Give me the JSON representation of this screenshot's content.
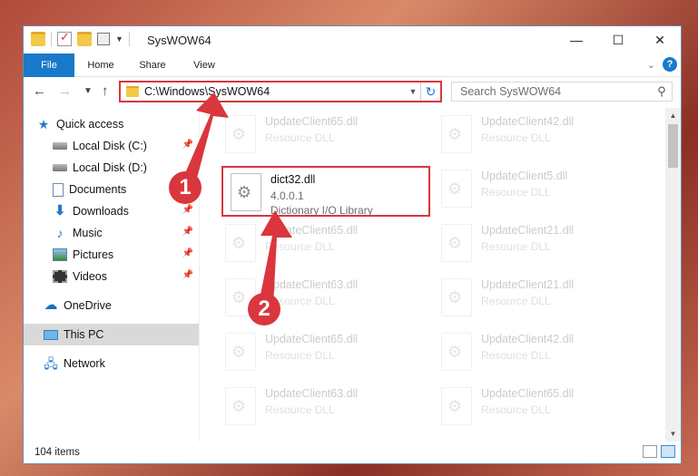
{
  "window": {
    "title": "SysWOW64",
    "minimize": "—",
    "maximize": "☐",
    "close": "✕"
  },
  "ribbon": {
    "tabs": [
      "File",
      "Home",
      "Share",
      "View"
    ]
  },
  "address": {
    "path": "C:\\Windows\\SysWOW64",
    "search_placeholder": "Search SysWOW64"
  },
  "nav": {
    "items": [
      {
        "label": "Quick access",
        "icon": "star-icon"
      },
      {
        "label": "Local Disk (C:)",
        "icon": "disk-icon",
        "pinned": true
      },
      {
        "label": "Local Disk (D:)",
        "icon": "disk-icon",
        "pinned": false
      },
      {
        "label": "Documents",
        "icon": "documents-icon",
        "pinned": true
      },
      {
        "label": "Downloads",
        "icon": "downloads-icon",
        "pinned": true
      },
      {
        "label": "Music",
        "icon": "music-icon",
        "pinned": true
      },
      {
        "label": "Pictures",
        "icon": "pictures-icon",
        "pinned": true
      },
      {
        "label": "Videos",
        "icon": "videos-icon",
        "pinned": true
      },
      {
        "label": "OneDrive",
        "icon": "cloud-icon"
      },
      {
        "label": "This PC",
        "icon": "computer-icon",
        "selected": true
      },
      {
        "label": "Network",
        "icon": "network-icon"
      }
    ]
  },
  "files": {
    "highlighted": {
      "name": "dict32.dll",
      "version": "4.0.0.1",
      "description": "Dictionary I/O Library"
    },
    "left_column": [
      {
        "name": "UpdateClient65.dll",
        "description": "Resource DLL"
      },
      {
        "name": "UpdateClient65.dll",
        "description": "Resource DLL"
      },
      {
        "name": "UpdateClient63.dll",
        "description": "Resource DLL"
      },
      {
        "name": "UpdateClient65.dll",
        "description": "Resource DLL"
      },
      {
        "name": "UpdateClient63.dll",
        "description": "Resource DLL"
      }
    ],
    "right_column": [
      {
        "name": "UpdateClient42.dll",
        "description": "Resource DLL"
      },
      {
        "name": "UpdateClient5.dll",
        "description": "Resource DLL"
      },
      {
        "name": "UpdateClient21.dll",
        "description": "Resource DLL"
      },
      {
        "name": "UpdateClient21.dll",
        "description": "Resource DLL"
      },
      {
        "name": "UpdateClient42.dll",
        "description": "Resource DLL"
      },
      {
        "name": "UpdateClient65.dll",
        "description": "Resource DLL"
      }
    ]
  },
  "status": {
    "item_count": "104 items"
  },
  "annotations": {
    "step1": "1",
    "step2": "2"
  },
  "colors": {
    "accent": "#1979ca",
    "highlight": "#d9363e"
  }
}
